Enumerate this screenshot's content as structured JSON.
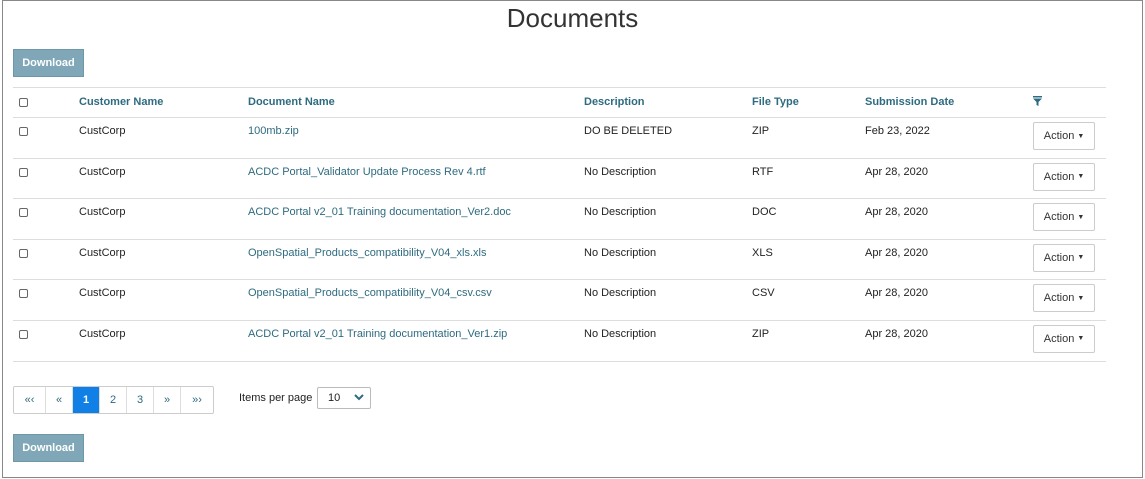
{
  "page": {
    "title": "Documents"
  },
  "buttons": {
    "download_top": "Download",
    "download_bottom": "Download"
  },
  "table": {
    "headers": {
      "customer": "Customer Name",
      "document": "Document Name",
      "description": "Description",
      "file_type": "File Type",
      "date": "Submission Date"
    },
    "filter_icon": "filter-icon",
    "action_label": "Action",
    "rows": [
      {
        "customer": "CustCorp",
        "document": "100mb.zip",
        "description": "DO BE DELETED",
        "type": "ZIP",
        "date": "Feb 23, 2022"
      },
      {
        "customer": "CustCorp",
        "document": "ACDC Portal_Validator Update Process Rev 4.rtf",
        "description": "No Description",
        "type": "RTF",
        "date": "Apr 28, 2020"
      },
      {
        "customer": "CustCorp",
        "document": "ACDC Portal v2_01 Training documentation_Ver2.doc",
        "description": "No Description",
        "type": "DOC",
        "date": "Apr 28, 2020"
      },
      {
        "customer": "CustCorp",
        "document": "OpenSpatial_Products_compatibility_V04_xls.xls",
        "description": "No Description",
        "type": "XLS",
        "date": "Apr 28, 2020"
      },
      {
        "customer": "CustCorp",
        "document": "OpenSpatial_Products_compatibility_V04_csv.csv",
        "description": "No Description",
        "type": "CSV",
        "date": "Apr 28, 2020"
      },
      {
        "customer": "CustCorp",
        "document": "ACDC Portal v2_01 Training documentation_Ver1.zip",
        "description": "No Description",
        "type": "ZIP",
        "date": "Apr 28, 2020"
      }
    ]
  },
  "pagination": {
    "first": "«‹",
    "prev": "«",
    "pages": [
      "1",
      "2",
      "3"
    ],
    "active_page": "1",
    "next": "»",
    "last": "»›",
    "items_per_page_label": "Items per page",
    "items_per_page_value": "10"
  },
  "colors": {
    "accent": "#2e6b80",
    "download_button": "#7fa7b8",
    "active_page": "#1080e6"
  }
}
